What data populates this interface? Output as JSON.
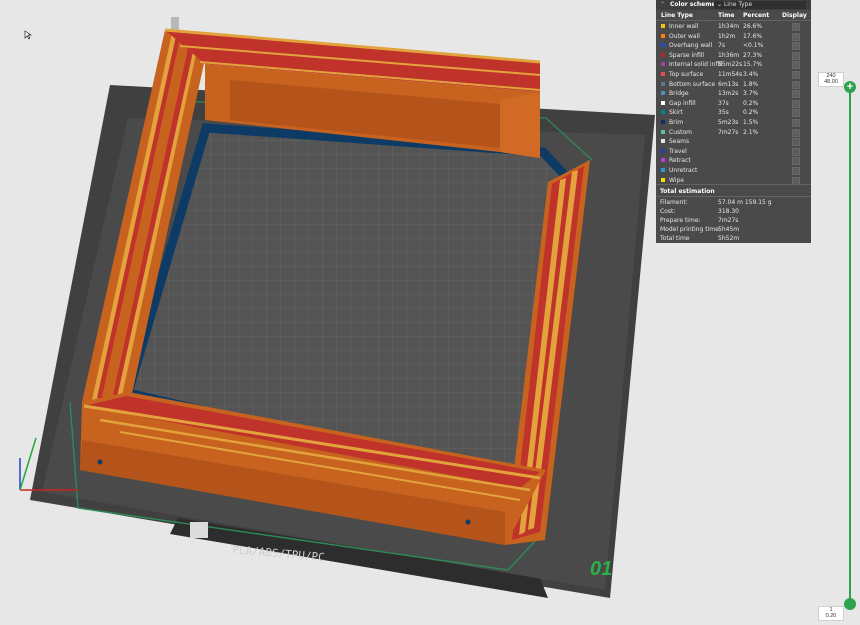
{
  "colors": {
    "background": "#e7e7e7",
    "bed": "#555555",
    "grid": "#5c5c5c",
    "wall_outer": "#c8621f",
    "wall_inner": "#e2a33c",
    "infill": "#c0332a",
    "brim": "#0d3b66",
    "accent": "#2ea24d"
  },
  "legend": {
    "title": "Color scheme",
    "scheme_value": "Line Type",
    "columns": {
      "type": "Line Type",
      "time": "Time",
      "percent": "Percent",
      "display": "Display"
    },
    "rows": [
      {
        "name": "Inner wall",
        "time": "1h34m",
        "percent": "26.6%",
        "color": "#f0c419",
        "checked": true
      },
      {
        "name": "Outer wall",
        "time": "1h2m",
        "percent": "17.6%",
        "color": "#ff7f0e",
        "checked": true
      },
      {
        "name": "Overhang wall",
        "time": "7s",
        "percent": "<0.1%",
        "color": "#1f4fcf",
        "checked": true
      },
      {
        "name": "Sparse infill",
        "time": "1h36m",
        "percent": "27.3%",
        "color": "#b3262b",
        "checked": true
      },
      {
        "name": "Internal solid infill",
        "time": "55m22s",
        "percent": "15.7%",
        "color": "#a43ea4",
        "checked": true
      },
      {
        "name": "Top surface",
        "time": "11m54s",
        "percent": "3.4%",
        "color": "#e34d4d",
        "checked": true
      },
      {
        "name": "Bottom surface",
        "time": "6m13s",
        "percent": "1.8%",
        "color": "#5c7b93",
        "checked": true
      },
      {
        "name": "Bridge",
        "time": "13m2s",
        "percent": "3.7%",
        "color": "#4c8fc0",
        "checked": true
      },
      {
        "name": "Gap infill",
        "time": "37s",
        "percent": "0.2%",
        "color": "#ffffff",
        "checked": true
      },
      {
        "name": "Skirt",
        "time": "35s",
        "percent": "0.2%",
        "color": "#00878a",
        "checked": true
      },
      {
        "name": "Brim",
        "time": "5m23s",
        "percent": "1.5%",
        "color": "#0a2f63",
        "checked": true
      },
      {
        "name": "Custom",
        "time": "7m27s",
        "percent": "2.1%",
        "color": "#5ec0a0",
        "checked": true
      },
      {
        "name": "Seams",
        "time": "",
        "percent": "",
        "color": "#e6e6e6",
        "checked": false
      },
      {
        "name": "Travel",
        "time": "",
        "percent": "",
        "color": "#2d3db0",
        "checked": false
      },
      {
        "name": "Retract",
        "time": "",
        "percent": "",
        "color": "#c63bd6",
        "checked": false
      },
      {
        "name": "Unretract",
        "time": "",
        "percent": "",
        "color": "#2a9ad6",
        "checked": false
      },
      {
        "name": "Wipe",
        "time": "",
        "percent": "",
        "color": "#f2e200",
        "checked": false
      }
    ],
    "total_title": "Total estimation",
    "estimates": [
      {
        "label": "Filament:",
        "value": "57.04 m    159.15 g"
      },
      {
        "label": "Cost:",
        "value": "318.30"
      },
      {
        "label": "Prepare time:",
        "value": "7m27s"
      },
      {
        "label": "Model printing time:",
        "value": "5h45m"
      },
      {
        "label": "Total time",
        "value": "5h52m"
      }
    ]
  },
  "layer_slider": {
    "top_layer": "240",
    "top_height": "48.00",
    "bottom_layer": "1",
    "bottom_height": "0.20"
  },
  "plate": {
    "label": "PLA/ABS/TPU/PC",
    "number": "01"
  }
}
